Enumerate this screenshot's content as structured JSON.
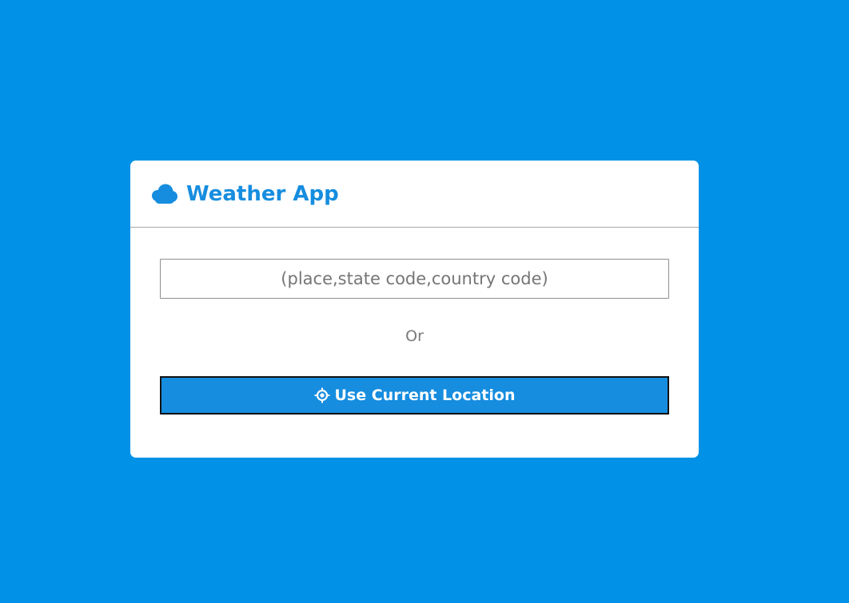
{
  "colors": {
    "page_background": "#0192e7",
    "accent": "#168ddf",
    "button_background": "#168ddf",
    "button_text": "#ffffff"
  },
  "header": {
    "icon": "cloud-icon",
    "title": "Weather App"
  },
  "search": {
    "value": "",
    "placeholder": "(place,state code,country code)"
  },
  "divider_text": "Or",
  "location_button": {
    "icon": "crosshair-icon",
    "label": "Use Current Location"
  }
}
